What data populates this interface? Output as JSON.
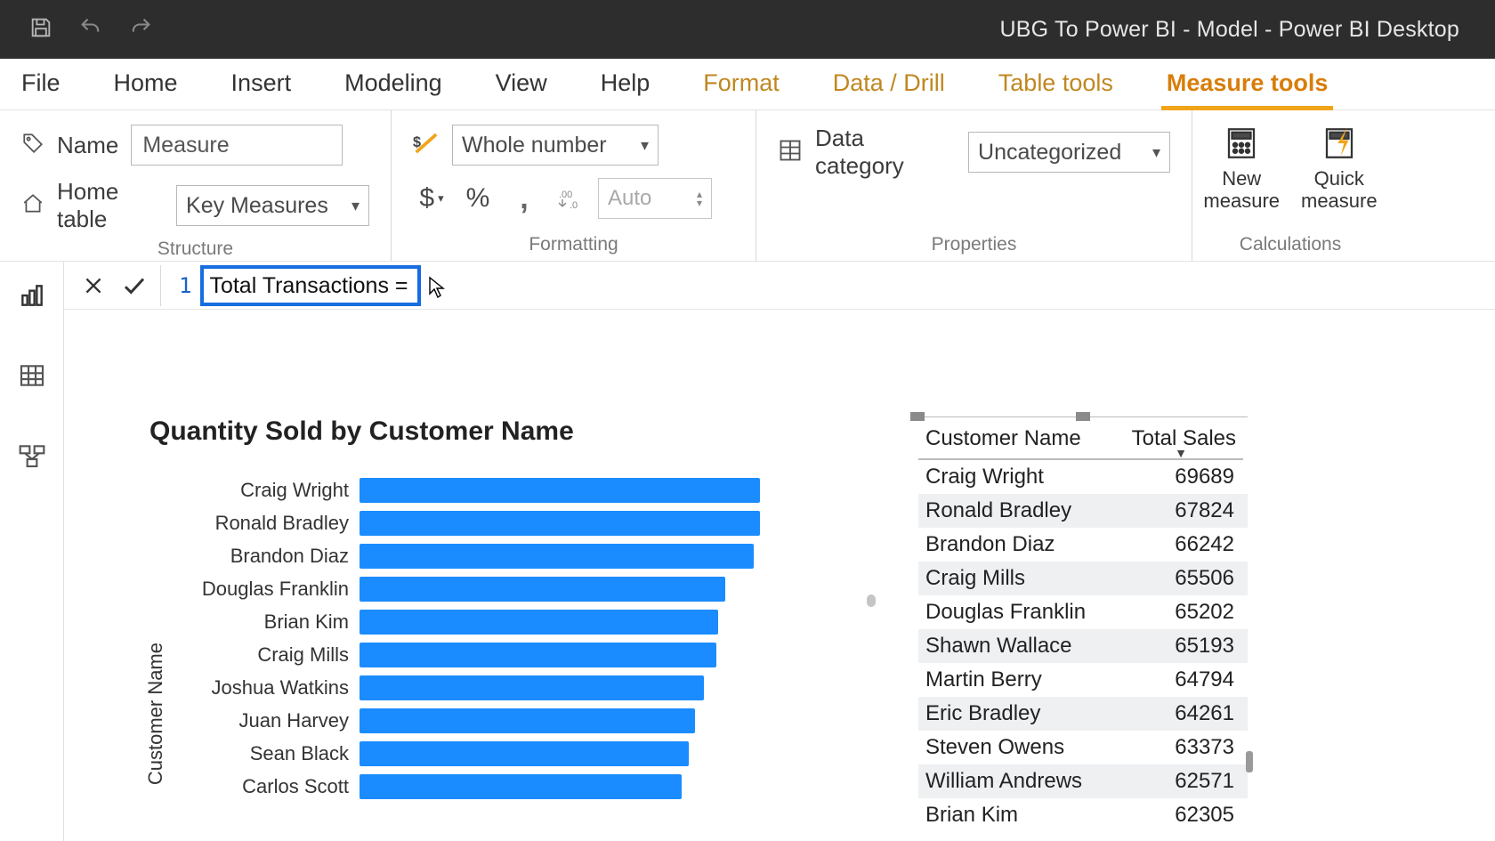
{
  "app_title": "UBG To Power BI - Model - Power BI Desktop",
  "ribbon_tabs": {
    "file": "File",
    "home": "Home",
    "insert": "Insert",
    "modeling": "Modeling",
    "view": "View",
    "help": "Help",
    "format": "Format",
    "datadrill": "Data / Drill",
    "tabletools": "Table tools",
    "measuretools": "Measure tools"
  },
  "ribbon": {
    "name_label": "Name",
    "name_value": "Measure",
    "home_table_label": "Home table",
    "home_table_value": "Key Measures",
    "format_select": "Whole number",
    "currency_symbol": "$",
    "percent": "%",
    "thousands": ",",
    "decimals_icon": ".00",
    "auto_value": "Auto",
    "data_category_label": "Data category",
    "data_category_value": "Uncategorized",
    "new_measure": "New measure",
    "quick_measure": "Quick measure",
    "group_structure": "Structure",
    "group_formatting": "Formatting",
    "group_properties": "Properties",
    "group_calculations": "Calculations"
  },
  "formula": {
    "line": "1",
    "text": "Total Transactions ="
  },
  "chart_data": {
    "type": "bar",
    "title": "Quantity Sold by Customer Name",
    "ylabel": "Customer Name",
    "xlabel": "",
    "xlim": [
      0,
      480
    ],
    "categories": [
      "Craig Wright",
      "Ronald Bradley",
      "Brandon Diaz",
      "Douglas Franklin",
      "Brian Kim",
      "Craig Mills",
      "Joshua Watkins",
      "Juan Harvey",
      "Sean Black",
      "Carlos Scott"
    ],
    "values": [
      460,
      460,
      452,
      420,
      412,
      410,
      395,
      385,
      378,
      370
    ]
  },
  "table": {
    "col_name": "Customer Name",
    "col_sales": "Total Sales",
    "rows": [
      {
        "name": "Craig Wright",
        "sales": "69689"
      },
      {
        "name": "Ronald Bradley",
        "sales": "67824"
      },
      {
        "name": "Brandon Diaz",
        "sales": "66242"
      },
      {
        "name": "Craig Mills",
        "sales": "65506"
      },
      {
        "name": "Douglas Franklin",
        "sales": "65202"
      },
      {
        "name": "Shawn Wallace",
        "sales": "65193"
      },
      {
        "name": "Martin Berry",
        "sales": "64794"
      },
      {
        "name": "Eric Bradley",
        "sales": "64261"
      },
      {
        "name": "Steven Owens",
        "sales": "63373"
      },
      {
        "name": "William Andrews",
        "sales": "62571"
      },
      {
        "name": "Brian Kim",
        "sales": "62305"
      }
    ]
  }
}
